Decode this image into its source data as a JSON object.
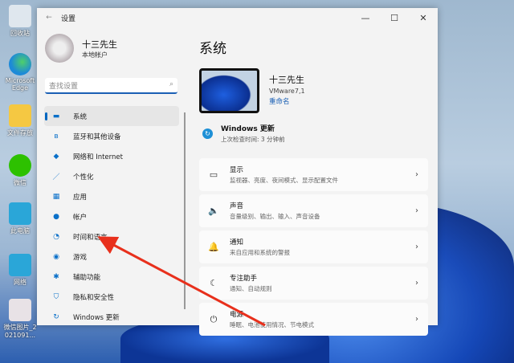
{
  "desktop": {
    "icons": [
      {
        "label": "回收站"
      },
      {
        "label": "Microsoft Edge"
      },
      {
        "label": "文件存放"
      },
      {
        "label": "微信"
      },
      {
        "label": "此电脑"
      },
      {
        "label": "网络"
      },
      {
        "label": "微信图片_2021091..."
      }
    ]
  },
  "window": {
    "title": "设置",
    "minimize": "—",
    "maximize": "☐",
    "close": "✕"
  },
  "profile": {
    "name": "十三先生",
    "account": "本地帐户"
  },
  "search": {
    "placeholder": "查找设置"
  },
  "nav": [
    {
      "label": "系统",
      "icon": "▬"
    },
    {
      "label": "蓝牙和其他设备",
      "icon": "ʙ"
    },
    {
      "label": "网络和 Internet",
      "icon": "◆"
    },
    {
      "label": "个性化",
      "icon": "／"
    },
    {
      "label": "应用",
      "icon": "▦"
    },
    {
      "label": "帐户",
      "icon": "●"
    },
    {
      "label": "时间和语言",
      "icon": "◔"
    },
    {
      "label": "游戏",
      "icon": "◉"
    },
    {
      "label": "辅助功能",
      "icon": "✱"
    },
    {
      "label": "隐私和安全性",
      "icon": "⛉"
    },
    {
      "label": "Windows 更新",
      "icon": "↻"
    }
  ],
  "main": {
    "title": "系统",
    "device": {
      "name": "十三先生",
      "model": "VMware7,1",
      "rename": "重命名"
    },
    "update": {
      "title": "Windows 更新",
      "subtitle": "上次检查时间: 3 分钟前"
    },
    "cards": [
      {
        "title": "显示",
        "subtitle": "监视器、亮度、夜间模式、显示配置文件",
        "icon": "▭"
      },
      {
        "title": "声音",
        "subtitle": "音量级别、输出、输入、声音设备",
        "icon": "🔈"
      },
      {
        "title": "通知",
        "subtitle": "来自应用和系统的警报",
        "icon": "🔔"
      },
      {
        "title": "专注助手",
        "subtitle": "通知、自动规则",
        "icon": "☾"
      },
      {
        "title": "电源",
        "subtitle": "睡眠、电池使用情况、节电模式",
        "icon": "⏻"
      }
    ]
  },
  "colors": {
    "accent": "#0067c0",
    "arrow": "#e8301c"
  }
}
